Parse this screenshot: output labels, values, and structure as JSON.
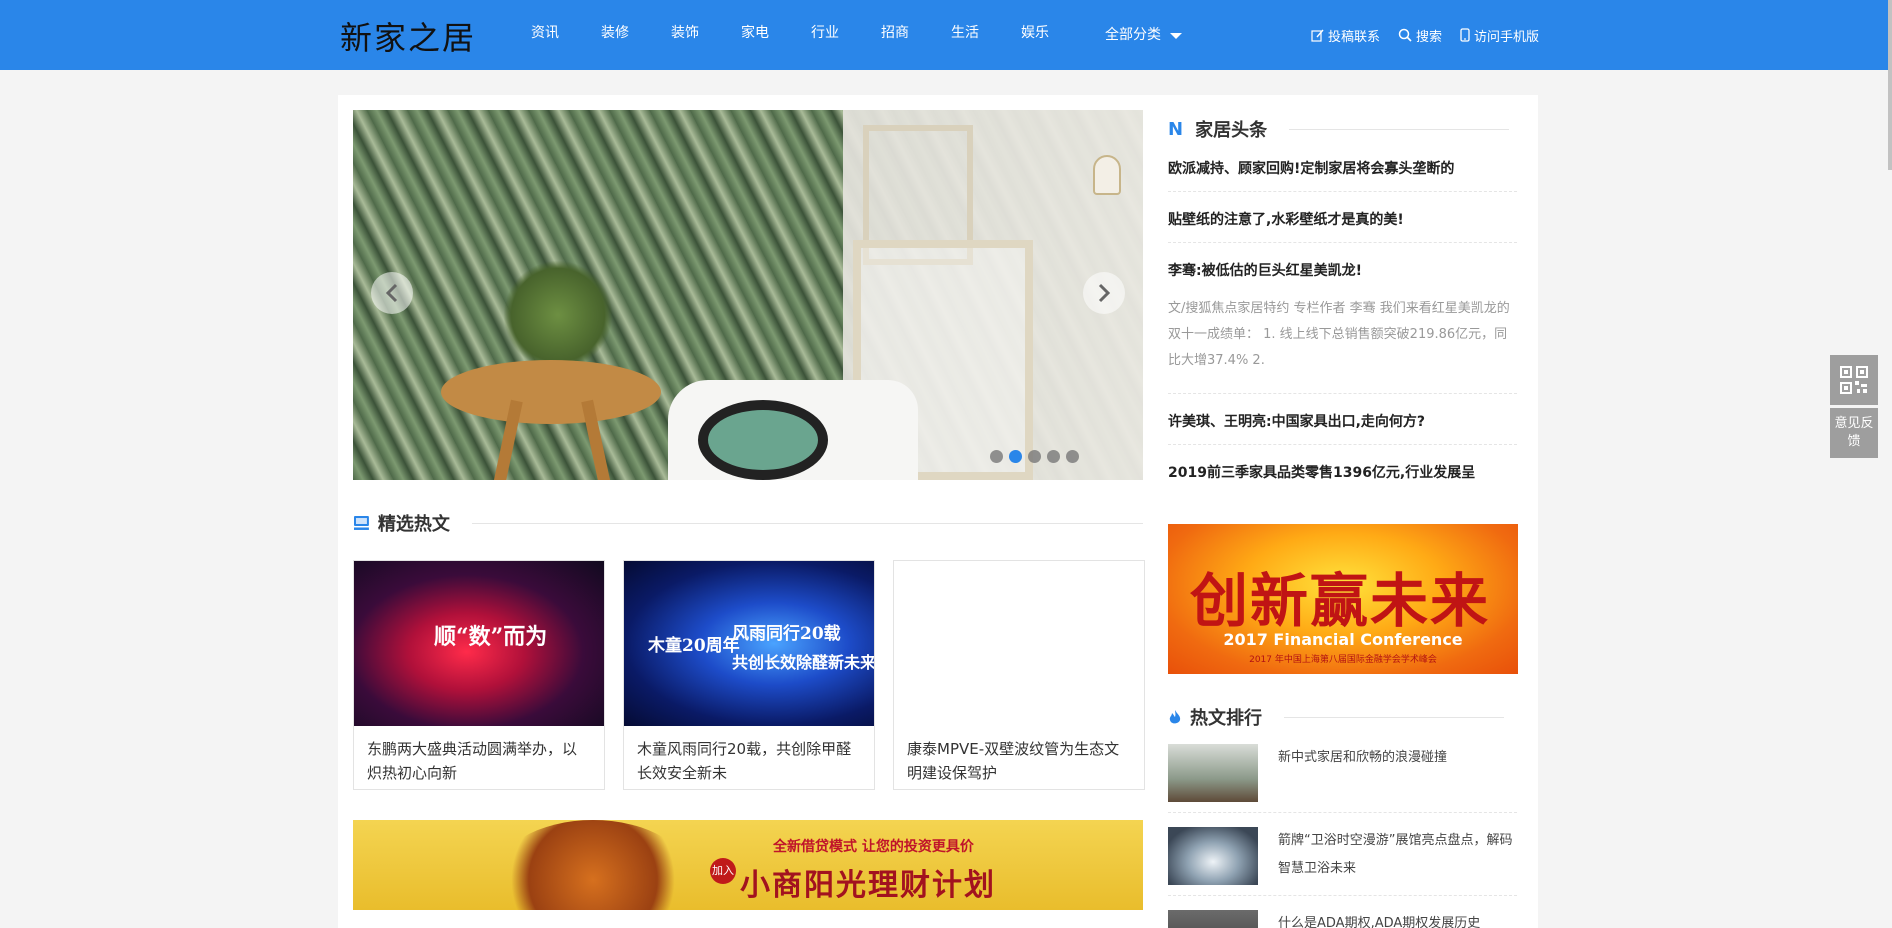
{
  "header": {
    "logo": "新家之居",
    "nav": [
      "资讯",
      "装修",
      "装饰",
      "家电",
      "行业",
      "招商",
      "生活",
      "娱乐"
    ],
    "all_categories": "全部分类",
    "tools": {
      "contribute": "投稿联系",
      "search": "搜索",
      "mobile": "访问手机版"
    },
    "bg_color": "#2a86e9"
  },
  "slider": {
    "total_dots": 5,
    "active_dot": 2
  },
  "featured": {
    "title": "精选热文",
    "items": [
      {
        "title": "东鹏两大盛典活动圆满举办，以炽热初心向新",
        "img_text": "顺“数”而为",
        "image": "stage-event"
      },
      {
        "title": "木童风雨同行20载，共创除甲醛长效安全新未",
        "img_text_a": "木童20周年",
        "img_text_b": "风雨同行20载",
        "img_text_c": "共创长效除醛新未来",
        "image": "anniversary-banner"
      },
      {
        "title": "康泰MPVE-双壁波纹管为生态文明建设保驾护",
        "image": "blank"
      }
    ]
  },
  "ad_banner": {
    "sub": "全新借贷模式 让您的投资更具价",
    "main": "小商阳光理财计划",
    "badge": "加入"
  },
  "sidebar": {
    "headlines_title": "家居头条",
    "headlines_icon": "N",
    "headlines": [
      "欧派减持、顾家回购!定制家居将会寡头垄断的",
      "贴壁纸的注意了,水彩壁纸才是真的美!",
      "李骞:被低估的巨头红星美凯龙!",
      "许美琪、王明亮:中国家具出口,走向何方?",
      "2019前三季家具品类零售1396亿元,行业发展呈"
    ],
    "headline_summary": "文/搜狐焦点家居特约 专栏作者 李骞 我们来看红星美凯龙的双十一成绩单： 1. 线上线下总销售额突破219.86亿元，同比大增37.4% 2.",
    "ad": {
      "main": "创新赢未来",
      "en": "2017 Financial Conference",
      "cn": "2017 年中国上海第八届国际金融学会学术峰会"
    },
    "ranking_title": "热文排行",
    "ranking": [
      "新中式家居和欣畅的浪漫碰撞",
      "箭牌“卫浴时空漫游”展馆亮点盘点，解码智慧卫浴未来",
      "什么是ADA期权,ADA期权发展历史"
    ]
  },
  "float": {
    "feedback": "意见反馈"
  }
}
